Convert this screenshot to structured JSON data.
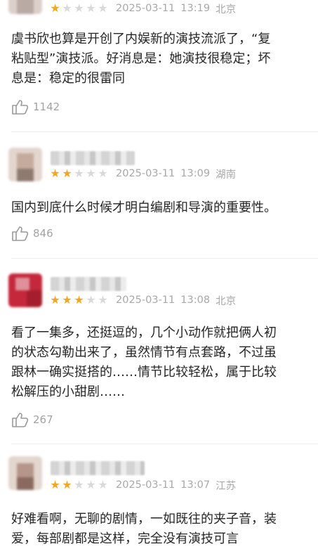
{
  "reviews": [
    {
      "rating": 1,
      "date": "2025-03-11",
      "time": "13:19",
      "location": "北京",
      "lines": [
        "虞书欣也算是开创了内娱新的演技流派了，“复",
        "粘贴型”演技派。好消息是：她演技很稳定；坏",
        "息是：稳定的很雷同"
      ],
      "likes": "1142",
      "avatar_colors": [
        "#e8ddd8",
        "#cfc1bb",
        "#b9aaa4",
        "#e2d6d2"
      ]
    },
    {
      "rating": 2,
      "date": "2025-03-11",
      "time": "13:09",
      "location": "湖南",
      "lines": [
        "国内到底什么时候才明白编剧和导演的重要性。"
      ],
      "likes": "846",
      "avatar_colors": [
        "#d9c6bb",
        "#b89d8e",
        "#e9dcd4",
        "#8f7a70"
      ]
    },
    {
      "rating": 3,
      "date": "2025-03-11",
      "time": "13:08",
      "location": "北京",
      "lines": [
        "看了一集多，还挺逗的，几个小动作就把俩人初",
        "的状态勾勒出来了，虽然情节有点套路，不过虽",
        "跟林一确实挺搭的……情节比较轻松，属于比较",
        "松解压的小甜剧……"
      ],
      "likes": "267",
      "avatar_colors": [
        "#c4283a",
        "#e0909b",
        "#a51e2f",
        "#d46070"
      ]
    },
    {
      "rating": 2,
      "date": "2025-03-11",
      "time": "13:07",
      "location": "江苏",
      "lines": [
        "好难看啊，无聊的剧情，一如既往的夹子音，装",
        "爱，每部剧都是这样，完全没有演技可言"
      ],
      "likes": "",
      "avatar_colors": [
        "#d7c5bd",
        "#8a6a5e",
        "#eadfd9",
        "#b59688"
      ]
    }
  ]
}
